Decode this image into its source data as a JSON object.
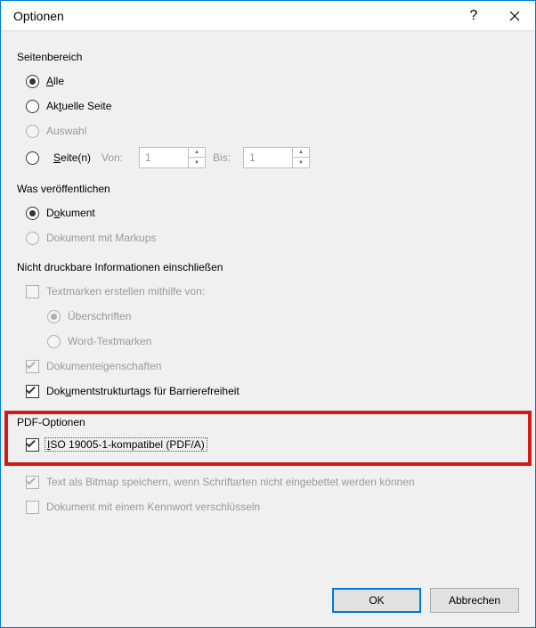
{
  "titlebar": {
    "title": "Optionen"
  },
  "groups": {
    "range_label": "Seitenbereich",
    "publish_label": "Was veröffentlichen",
    "nonprint_label": "Nicht druckbare Informationen einschließen",
    "pdfopts_label": "PDF-Optionen"
  },
  "range": {
    "all": "Alle",
    "current": "Aktuelle Seite",
    "selection": "Auswahl",
    "pages": "Seite(n)",
    "from_label": "Von:",
    "to_label": "Bis:",
    "from_value": "1",
    "to_value": "1"
  },
  "publish": {
    "document": "Dokument",
    "document_markups": "Dokument mit Markups"
  },
  "nonprint": {
    "bookmarks": "Textmarken erstellen mithilfe von:",
    "headings": "Überschriften",
    "word_bookmarks": "Word-Textmarken",
    "docprops": "Dokumenteigenschaften",
    "structtags": "Dokumentstrukturtags für Barrierefreiheit"
  },
  "pdfopts": {
    "iso": "ISO 19005-1-kompatibel (PDF/A)",
    "bitmap": "Text als Bitmap speichern, wenn Schriftarten nicht eingebettet werden können",
    "encrypt": "Dokument mit einem Kennwort verschlüsseln"
  },
  "footer": {
    "ok": "OK",
    "cancel": "Abbrechen"
  }
}
